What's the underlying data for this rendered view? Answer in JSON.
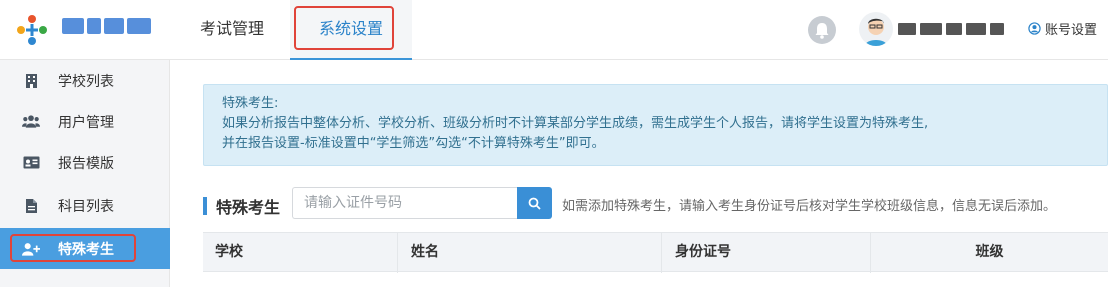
{
  "header": {
    "nav": [
      {
        "label": "考试管理"
      },
      {
        "label": "系统设置"
      }
    ],
    "account_label": "账号设置"
  },
  "sidebar": {
    "items": [
      {
        "label": "学校列表",
        "icon": "building-icon"
      },
      {
        "label": "用户管理",
        "icon": "users-icon"
      },
      {
        "label": "报告模版",
        "icon": "id-card-icon"
      },
      {
        "label": "科目列表",
        "icon": "file-icon"
      },
      {
        "label": "特殊考生",
        "icon": "user-plus-icon",
        "active": true
      }
    ]
  },
  "notice": {
    "title": "特殊考生:",
    "line1": "如果分析报告中整体分析、学校分析、班级分析时不计算某部分学生成绩，需生成学生个人报告，请将学生设置为特殊考生,",
    "line2": "并在报告设置-标准设置中“学生筛选”勾选“不计算特殊考生”即可。"
  },
  "main": {
    "section_title": "特殊考生",
    "search_placeholder": "请输入证件号码",
    "hint": "如需添加特殊考生，请输入考生身份证号后核对学生学校班级信息，信息无误后添加。",
    "columns": [
      "学校",
      "姓名",
      "身份证号",
      "班级"
    ]
  },
  "colors": {
    "accent": "#3b8fd6",
    "active_sidebar": "#4a9ee0",
    "notice_bg": "#dceef8",
    "notice_text": "#31708f",
    "highlight_box": "#e0443a"
  }
}
